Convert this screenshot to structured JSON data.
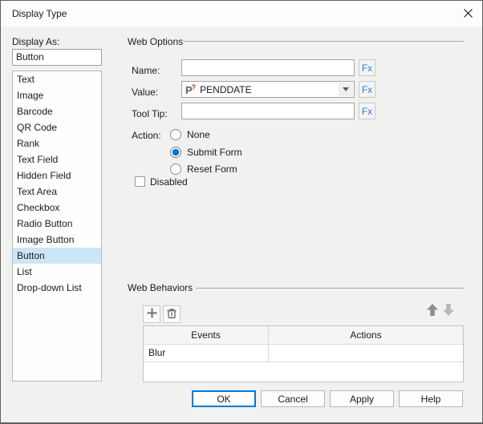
{
  "window": {
    "title": "Display Type"
  },
  "display_as": {
    "label": "Display As:",
    "value": "Button",
    "selected_index": 11,
    "options": [
      "Text",
      "Image",
      "Barcode",
      "QR Code",
      "Rank",
      "Text Field",
      "Hidden Field",
      "Text Area",
      "Checkbox",
      "Radio Button",
      "Image Button",
      "Button",
      "List",
      "Drop-down List"
    ]
  },
  "web_options": {
    "section_title": "Web Options",
    "name_label": "Name:",
    "name_value": "",
    "value_label": "Value:",
    "value_text": "PENDDATE",
    "value_icon": "parameter-icon",
    "tooltip_label": "Tool Tip:",
    "tooltip_value": "",
    "fx_label": "Fx",
    "action_label": "Action:",
    "actions": [
      {
        "label": "None",
        "selected": false
      },
      {
        "label": "Submit Form",
        "selected": true
      },
      {
        "label": "Reset Form",
        "selected": false
      }
    ],
    "disabled_label": "Disabled",
    "disabled_checked": false
  },
  "web_behaviors": {
    "section_title": "Web Behaviors",
    "columns": [
      "Events",
      "Actions"
    ],
    "rows": [
      {
        "events": "Blur",
        "actions": ""
      }
    ]
  },
  "footer": {
    "ok": "OK",
    "cancel": "Cancel",
    "apply": "Apply",
    "help": "Help"
  },
  "colors": {
    "accent_blue": "#0078d7",
    "fx_blue": "#2b7cd3",
    "selection_blue": "#cbe6f7",
    "param_red": "#cf3b2c"
  }
}
